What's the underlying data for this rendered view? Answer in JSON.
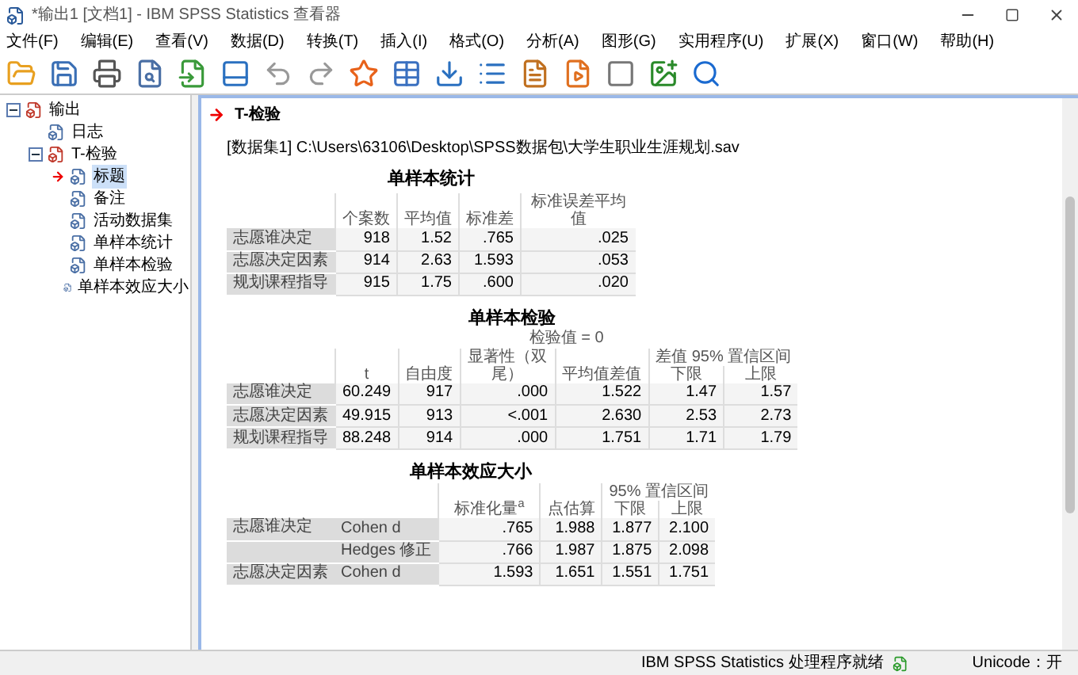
{
  "window": {
    "title": "*输出1 [文档1] - IBM SPSS Statistics 查看器"
  },
  "menu": [
    "文件(F)",
    "编辑(E)",
    "查看(V)",
    "数据(D)",
    "转换(T)",
    "插入(I)",
    "格式(O)",
    "分析(A)",
    "图形(G)",
    "实用程序(U)",
    "扩展(X)",
    "窗口(W)",
    "帮助(H)"
  ],
  "outline": [
    {
      "label": "输出",
      "expanded": true,
      "children": [
        {
          "label": "日志",
          "selected": false
        },
        {
          "label": "T-检验",
          "expanded": true,
          "children": [
            {
              "label": "标题",
              "selected": true
            },
            {
              "label": "备注",
              "selected": false
            },
            {
              "label": "活动数据集",
              "selected": false
            },
            {
              "label": "单样本统计",
              "selected": false
            },
            {
              "label": "单样本检验",
              "selected": false
            },
            {
              "label": "单样本效应大小",
              "selected": false
            }
          ]
        }
      ]
    }
  ],
  "content": {
    "heading": "T-检验",
    "dataset_path": "[数据集1] C:\\Users\\63106\\Desktop\\SPSS数据包\\大学生职业生涯规划.sav",
    "stats_table": {
      "title": "单样本统计",
      "columns": [
        "个案数",
        "平均值",
        "标准差",
        "标准误差平均值"
      ],
      "rows": [
        {
          "label": "志愿谁决定",
          "values": [
            "918",
            "1.52",
            ".765",
            ".025"
          ]
        },
        {
          "label": "志愿决定因素",
          "values": [
            "914",
            "2.63",
            "1.593",
            ".053"
          ]
        },
        {
          "label": "规划课程指导",
          "values": [
            "915",
            "1.75",
            ".600",
            ".020"
          ]
        }
      ]
    },
    "test_table": {
      "title": "单样本检验",
      "test_value": "检验值 = 0",
      "ci_header": "差值 95% 置信区间",
      "columns": [
        "t",
        "自由度",
        "显著性（双尾）",
        "平均值差值",
        "下限",
        "上限"
      ],
      "rows": [
        {
          "label": "志愿谁决定",
          "values": [
            "60.249",
            "917",
            ".000",
            "1.522",
            "1.47",
            "1.57"
          ]
        },
        {
          "label": "志愿决定因素",
          "values": [
            "49.915",
            "913",
            "<.001",
            "2.630",
            "2.53",
            "2.73"
          ]
        },
        {
          "label": "规划课程指导",
          "values": [
            "88.248",
            "914",
            ".000",
            "1.751",
            "1.71",
            "1.79"
          ]
        }
      ]
    },
    "effect_table": {
      "title": "单样本效应大小",
      "ci_header": "95% 置信区间",
      "columns": [
        "标准化量$^{a}$",
        "点估算",
        "下限",
        "上限"
      ],
      "rows": [
        {
          "group": "志愿谁决定",
          "label": "Cohen d",
          "values": [
            ".765",
            "1.988",
            "1.877",
            "2.100"
          ]
        },
        {
          "label": "Hedges 修正",
          "values": [
            ".766",
            "1.987",
            "1.875",
            "2.098"
          ]
        },
        {
          "group": "志愿决定因素",
          "label": "Cohen d",
          "values": [
            "1.593",
            "1.651",
            "1.551",
            "1.751"
          ]
        }
      ]
    }
  },
  "status_bar": {
    "message": "IBM SPSS Statistics 处理程序就绪",
    "unicode": "Unicode：开"
  }
}
